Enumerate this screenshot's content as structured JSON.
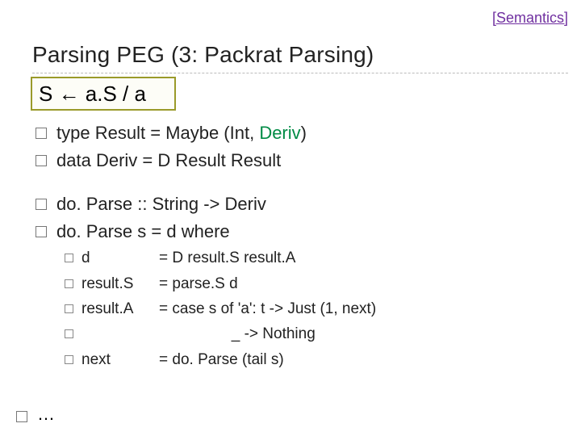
{
  "header": {
    "link": "[Semantics]"
  },
  "title": "Parsing PEG (3: Packrat Parsing)",
  "grammar": "S ← a.S / a",
  "lines": {
    "type_prefix": "type",
    "type_rest_a": "Result = Maybe (Int, ",
    "type_deriv": "Deriv",
    "type_rest_b": ")",
    "data_prefix": "data",
    "data_rest": "Deriv  = D Result Result",
    "sig_prefix": "do. Parse",
    "sig_rest": " :: String -> Deriv",
    "def_prefix": "do. Parse",
    "def_rest": " s = d where"
  },
  "where": {
    "d_lhs": "d",
    "d_rhs": "= D result.S result.A",
    "rs_lhs": "result.S",
    "rs_rhs": "= parse.S d",
    "ra_lhs": "result.A",
    "ra_rhs": "= case s of 'a': t -> Just (1, next)",
    "blank_lhs": "",
    "blank_rhs": "                 _ -> Nothing",
    "nx_lhs": "next",
    "nx_rhs": "= do. Parse (tail s)"
  },
  "ellipsis": "…"
}
